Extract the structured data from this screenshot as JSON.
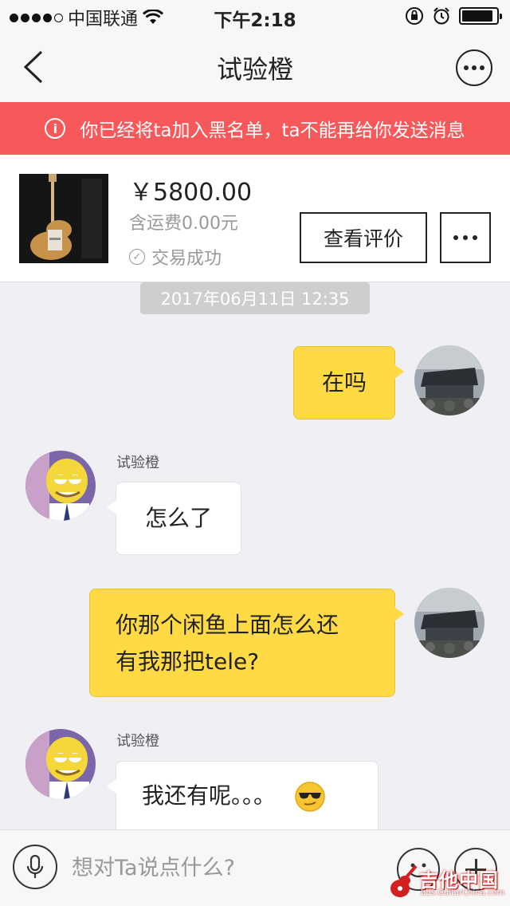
{
  "status_bar": {
    "carrier": "中国联通",
    "time": "下午2:18",
    "signal_bars_filled": 4,
    "signal_bars_total": 5,
    "battery_level": 0.9
  },
  "nav": {
    "title": "试验橙",
    "back_icon": "chevron-left-icon",
    "more_icon": "ellipsis-circle-icon"
  },
  "banner": {
    "text": "你已经将ta加入黑名单，ta不能再给你发送消息",
    "icon_glyph": "i",
    "color": "#f7595b"
  },
  "product": {
    "price": "￥5800.00",
    "shipping": "含运费0.00元",
    "status": "交易成功",
    "review_button": "查看评价",
    "more_button_icon": "ellipsis-icon"
  },
  "chat": {
    "timestamp": "2017年06月11日 12:35",
    "messages": [
      {
        "direction": "out",
        "text": "在吗"
      },
      {
        "direction": "in",
        "sender": "试验橙",
        "text": "怎么了"
      },
      {
        "direction": "out",
        "lines": [
          "你那个闲鱼上面怎么还",
          "有我那把tele?"
        ]
      },
      {
        "direction": "in",
        "sender": "试验橙",
        "text": "我还有呢。。。",
        "emoji": "sunglasses-emoji"
      }
    ]
  },
  "input_bar": {
    "placeholder": "想对Ta说点什么?",
    "mic_icon": "microphone-icon",
    "emoji_icon": "smiley-icon",
    "plus_icon": "plus-icon"
  },
  "watermark": {
    "title": "吉他中国",
    "url": "bbs.GuitarChina.com"
  },
  "colors": {
    "outgoing_bubble": "#ffda44",
    "incoming_bubble": "#ffffff",
    "background": "#efeff4"
  }
}
